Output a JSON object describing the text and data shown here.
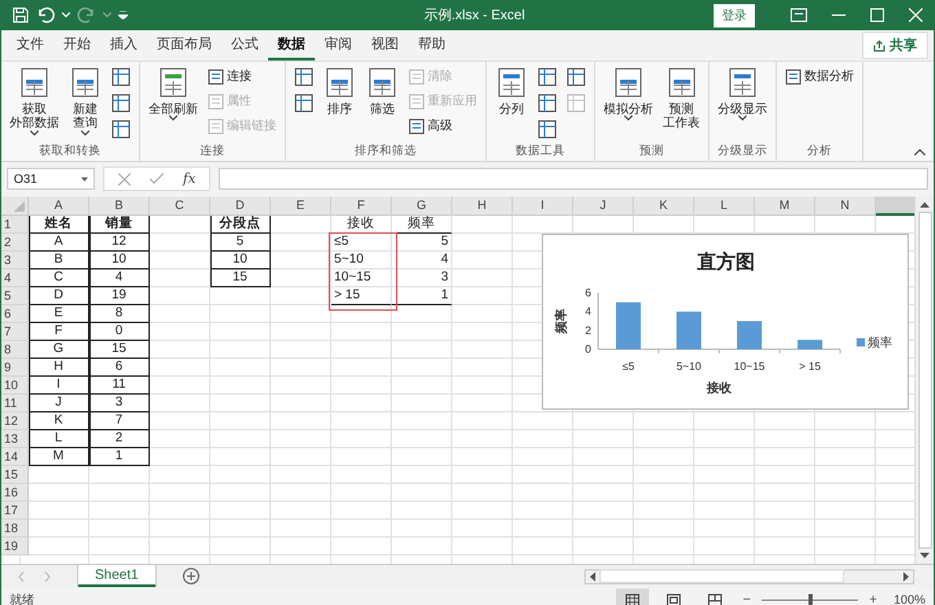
{
  "window": {
    "title": "示例.xlsx  -  Excel",
    "sign_in": "登录"
  },
  "menu_tabs": [
    {
      "label": "文件",
      "selected": false
    },
    {
      "label": "开始",
      "selected": false
    },
    {
      "label": "插入",
      "selected": false
    },
    {
      "label": "页面布局",
      "selected": false
    },
    {
      "label": "公式",
      "selected": false
    },
    {
      "label": "数据",
      "selected": true
    },
    {
      "label": "审阅",
      "selected": false
    },
    {
      "label": "视图",
      "selected": false
    },
    {
      "label": "帮助",
      "selected": false
    }
  ],
  "share_button": "共享",
  "ribbon_groups": [
    {
      "label": "获取和转换",
      "columns": [
        {
          "kind": "large",
          "lines": [
            "获取",
            "外部数据"
          ],
          "dropdown": true
        },
        {
          "kind": "large",
          "lines": [
            "新建",
            "查询"
          ],
          "dropdown": true
        },
        {
          "kind": "stack",
          "items": [
            {
              "disabled": false
            },
            {
              "disabled": false
            },
            {
              "disabled": false
            }
          ]
        }
      ]
    },
    {
      "label": "连接",
      "columns": [
        {
          "kind": "large",
          "lines": [
            "全部刷新"
          ],
          "dropdown": true
        },
        {
          "kind": "stack",
          "items": [
            {
              "label": "连接",
              "disabled": false
            },
            {
              "label": "属性",
              "disabled": true
            },
            {
              "label": "编辑链接",
              "disabled": true
            }
          ]
        }
      ]
    },
    {
      "label": "排序和筛选",
      "columns": [
        {
          "kind": "stack",
          "items": [
            {
              "disabled": false
            },
            {
              "disabled": false
            }
          ]
        },
        {
          "kind": "large",
          "lines": [
            "排序"
          ],
          "dropdown": false
        },
        {
          "kind": "large",
          "lines": [
            "筛选"
          ],
          "dropdown": false
        },
        {
          "kind": "stack",
          "items": [
            {
              "label": "清除",
              "disabled": true
            },
            {
              "label": "重新应用",
              "disabled": true
            },
            {
              "label": "高级",
              "disabled": false
            }
          ]
        }
      ]
    },
    {
      "label": "数据工具",
      "columns": [
        {
          "kind": "large",
          "lines": [
            "分列"
          ],
          "dropdown": false
        },
        {
          "kind": "stack",
          "items": [
            {
              "disabled": false
            },
            {
              "disabled": false
            },
            {
              "disabled": false
            }
          ]
        },
        {
          "kind": "stack",
          "items": [
            {
              "disabled": false
            },
            {
              "disabled": true
            }
          ]
        }
      ]
    },
    {
      "label": "预测",
      "columns": [
        {
          "kind": "large",
          "lines": [
            "模拟分析"
          ],
          "dropdown": true
        },
        {
          "kind": "large",
          "lines": [
            "预测",
            "工作表"
          ],
          "dropdown": false
        }
      ]
    },
    {
      "label": "分级显示",
      "columns": [
        {
          "kind": "large",
          "lines": [
            "分级显示"
          ],
          "dropdown": true
        }
      ]
    },
    {
      "label": "分析",
      "columns": [
        {
          "kind": "stack",
          "items": [
            {
              "label": "数据分析",
              "disabled": false
            }
          ]
        }
      ]
    }
  ],
  "formula_bar": {
    "name_box": "O31",
    "function_label": "fx"
  },
  "sheet": {
    "columns": [
      {
        "label": "A",
        "selected": false
      },
      {
        "label": "B",
        "selected": false
      },
      {
        "label": "C",
        "selected": false
      },
      {
        "label": "D",
        "selected": false
      },
      {
        "label": "E",
        "selected": false
      },
      {
        "label": "F",
        "selected": false
      },
      {
        "label": "G",
        "selected": false
      },
      {
        "label": "H",
        "selected": false
      },
      {
        "label": "I",
        "selected": false
      },
      {
        "label": "J",
        "selected": false
      },
      {
        "label": "K",
        "selected": false
      },
      {
        "label": "L",
        "selected": false
      },
      {
        "label": "M",
        "selected": false
      },
      {
        "label": "N",
        "selected": false
      },
      {
        "selected": true
      }
    ],
    "rows": [
      {
        "header": "1",
        "cells": [
          "姓名",
          "销量",
          null,
          "分段点",
          null,
          "接收",
          "频率"
        ]
      },
      {
        "header": "2",
        "cells": [
          "A",
          "12",
          null,
          "5",
          null,
          "≤5",
          "5"
        ]
      },
      {
        "header": "3",
        "cells": [
          "B",
          "10",
          null,
          "10",
          null,
          "5~10",
          "4"
        ]
      },
      {
        "header": "4",
        "cells": [
          "C",
          "4",
          null,
          "15",
          null,
          "10~15",
          "3"
        ]
      },
      {
        "header": "5",
        "cells": [
          "D",
          "19",
          null,
          null,
          null,
          "> 15",
          "1"
        ]
      },
      {
        "header": "6",
        "cells": [
          "E",
          "8"
        ]
      },
      {
        "header": "7",
        "cells": [
          "F",
          "0"
        ]
      },
      {
        "header": "8",
        "cells": [
          "G",
          "15"
        ]
      },
      {
        "header": "9",
        "cells": [
          "H",
          "6"
        ]
      },
      {
        "header": "10",
        "cells": [
          "I",
          "11"
        ]
      },
      {
        "header": "11",
        "cells": [
          "J",
          "3"
        ]
      },
      {
        "header": "12",
        "cells": [
          "K",
          "7"
        ]
      },
      {
        "header": "13",
        "cells": [
          "L",
          "2"
        ]
      },
      {
        "header": "14",
        "cells": [
          "M",
          "1"
        ]
      },
      {
        "header": "15"
      },
      {
        "header": "16"
      },
      {
        "header": "17"
      },
      {
        "header": "18"
      },
      {
        "header": "19"
      }
    ]
  },
  "chart": {
    "chart_data": {
      "type": "bar",
      "title": "直方图",
      "xlabel": "接收",
      "ylabel": "频率",
      "categories": [
        "≤5",
        "5~10",
        "10~15",
        "> 15"
      ],
      "series": [
        {
          "name": "频率",
          "color": "#5b9bd5",
          "values": [
            5,
            4,
            3,
            1
          ]
        }
      ],
      "ylim": [
        0,
        6
      ],
      "yticks": [
        0,
        2,
        4,
        6
      ]
    }
  },
  "sheet_tabs": [
    {
      "label": "Sheet1",
      "selected": true
    }
  ],
  "status_bar": {
    "status": "就绪",
    "views": [
      {
        "selected": true
      },
      {
        "selected": false
      },
      {
        "selected": false
      }
    ],
    "zoom_out": "−",
    "zoom_in": "+",
    "zoom": "100%",
    "zoom_level": {
      "level": 0.5
    }
  }
}
